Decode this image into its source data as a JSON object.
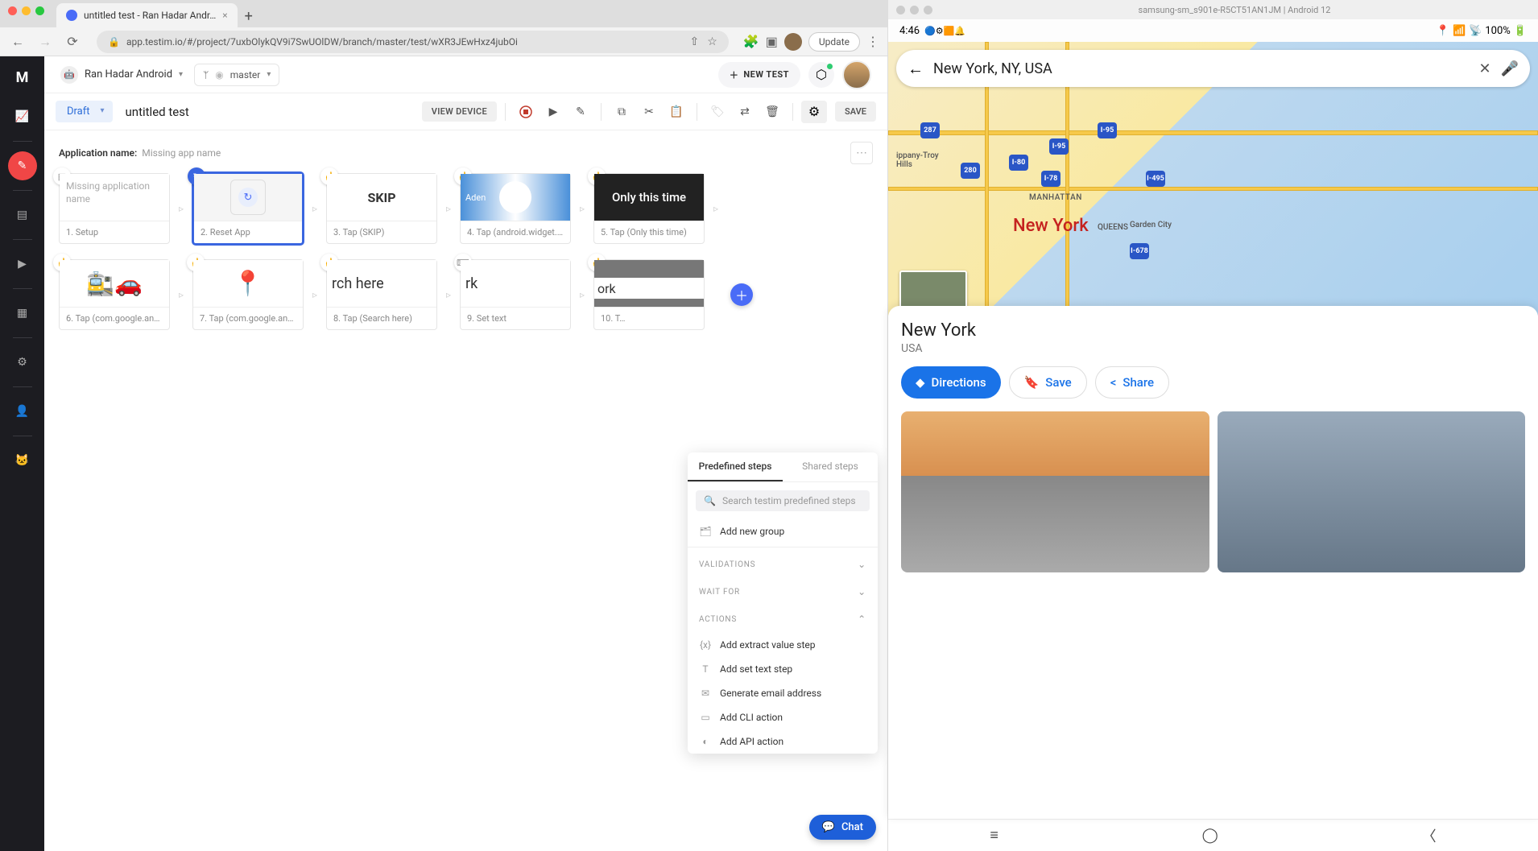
{
  "browser": {
    "tab_title": "untitled test - Ran Hadar Andr…",
    "url": "app.testim.io/#/project/7uxbOlykQV9i7SwUOlDW/branch/master/test/wXR3JEwHxz4jubOi",
    "update_label": "Update"
  },
  "header": {
    "project_name": "Ran Hadar Android",
    "branch_name": "master",
    "new_test_label": "NEW TEST"
  },
  "subheader": {
    "draft_label": "Draft",
    "test_title": "untitled test",
    "view_device_label": "VIEW DEVICE",
    "save_label": "SAVE"
  },
  "canvas": {
    "app_name_label": "Application name:",
    "app_name_value": "Missing app name",
    "missing_card_text": "Missing application name"
  },
  "steps": [
    {
      "label": "1. Setup",
      "thumb_text": ""
    },
    {
      "label": "2. Reset App",
      "thumb_text": ""
    },
    {
      "label": "3. Tap (SKIP)",
      "thumb_text": "SKIP"
    },
    {
      "label": "4. Tap (android.widget.I…",
      "thumb_text": "Aden"
    },
    {
      "label": "5. Tap (Only this time)",
      "thumb_text": "Only this time"
    },
    {
      "label": "6. Tap (com.google.andr…",
      "thumb_text": ""
    },
    {
      "label": "7. Tap (com.google.andr…",
      "thumb_text": ""
    },
    {
      "label": "8. Tap (Search here)",
      "thumb_text": "rch here"
    },
    {
      "label": "9. Set text",
      "thumb_text": "rk"
    },
    {
      "label": "10. T…",
      "thumb_text": "ork"
    }
  ],
  "popover": {
    "tab_predefined": "Predefined steps",
    "tab_shared": "Shared steps",
    "search_placeholder": "Search testim predefined steps",
    "add_group": "Add new group",
    "section_validations": "Validations",
    "section_waitfor": "Wait for",
    "section_actions": "Actions",
    "actions": [
      "Add extract value step",
      "Add set text step",
      "Generate email address",
      "Add CLI action",
      "Add API action"
    ]
  },
  "chat_label": "Chat",
  "device": {
    "window_title": "samsung-sm_s901e-R5CT51AN1JM | Android 12",
    "time": "4:46",
    "battery": "100%",
    "search_value": "New York, NY, USA",
    "place_title": "New York",
    "place_sub": "USA",
    "directions_label": "Directions",
    "save_label": "Save",
    "share_label": "Share",
    "map_labels": {
      "ny": "New York",
      "manhattan": "MANHATTAN",
      "queens": "QUEENS",
      "hills": "ippany-Troy\nHills",
      "garden": "Garden City"
    }
  }
}
